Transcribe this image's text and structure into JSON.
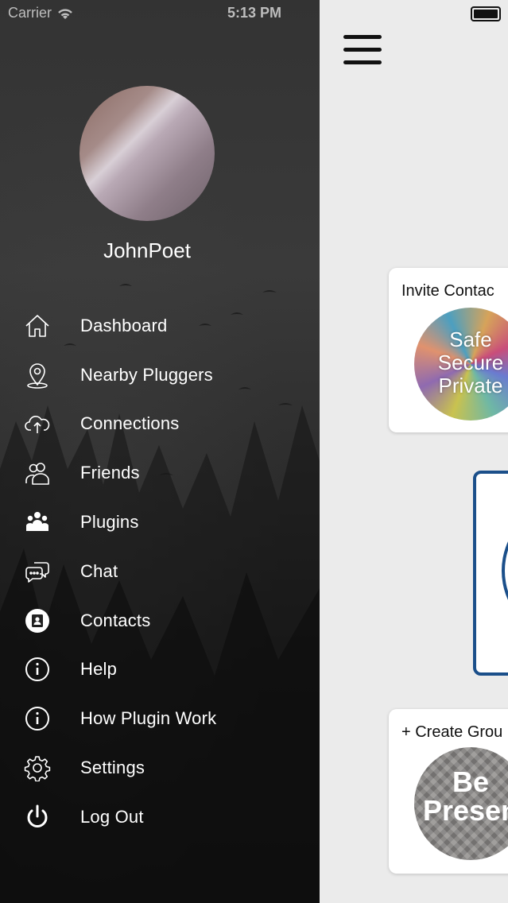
{
  "status_bar": {
    "carrier": "Carrier",
    "time": "5:13 PM"
  },
  "profile": {
    "username": "JohnPoet"
  },
  "menu": [
    {
      "label": "Dashboard",
      "icon": "home-icon"
    },
    {
      "label": "Nearby Pluggers",
      "icon": "location-pin-icon"
    },
    {
      "label": "Connections",
      "icon": "cloud-upload-icon"
    },
    {
      "label": "Friends",
      "icon": "users-icon"
    },
    {
      "label": "Plugins",
      "icon": "group-icon"
    },
    {
      "label": "Chat",
      "icon": "chat-icon"
    },
    {
      "label": "Contacts",
      "icon": "contacts-icon"
    },
    {
      "label": "Help",
      "icon": "info-icon"
    },
    {
      "label": "How Plugin Work",
      "icon": "info-icon"
    },
    {
      "label": "Settings",
      "icon": "gear-icon"
    },
    {
      "label": "Log Out",
      "icon": "power-icon"
    }
  ],
  "cards": {
    "invite": {
      "title": "Invite Contac",
      "badge_lines": [
        "Safe",
        "Secure",
        "Private"
      ]
    },
    "create_group": {
      "title": "+ Create Grou",
      "badge_lines": [
        "Be",
        "Presen"
      ]
    }
  },
  "colors": {
    "drawer_text": "#ffffff",
    "accent_blue": "#1b4f8a",
    "content_bg": "#ebebeb"
  }
}
